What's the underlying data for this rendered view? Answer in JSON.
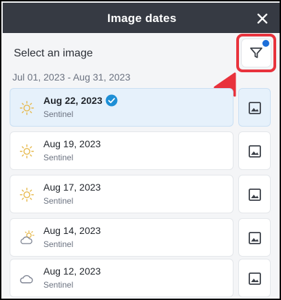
{
  "dialog": {
    "title": "Image dates",
    "close_icon": "close-icon"
  },
  "main": {
    "select_label": "Select an image",
    "date_range": "Jul 01, 2023 - Aug 31, 2023",
    "filter": {
      "icon": "filter-icon",
      "active_indicator_color": "#1e6fd9"
    },
    "annotation": {
      "highlight_color": "#e8323c"
    }
  },
  "images": [
    {
      "date": "Aug 22, 2023",
      "source": "Sentinel",
      "weather": "sun-icon",
      "selected": true
    },
    {
      "date": "Aug 19, 2023",
      "source": "Sentinel",
      "weather": "sun-icon",
      "selected": false
    },
    {
      "date": "Aug 17, 2023",
      "source": "Sentinel",
      "weather": "sun-icon",
      "selected": false
    },
    {
      "date": "Aug 14, 2023",
      "source": "Sentinel",
      "weather": "partly-cloudy-icon",
      "selected": false
    },
    {
      "date": "Aug 12, 2023",
      "source": "Sentinel",
      "weather": "cloud-icon",
      "selected": false
    }
  ],
  "colors": {
    "header_bg": "#363a43",
    "selected_bg": "#e6f1fb",
    "check": "#1e8fd6",
    "sun": "#e6b84a"
  }
}
